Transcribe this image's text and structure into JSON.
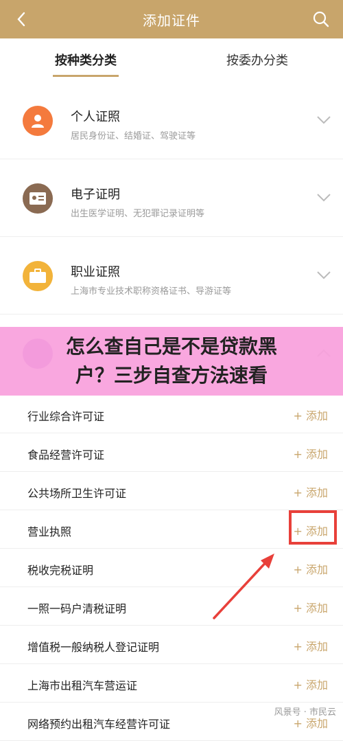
{
  "header": {
    "title": "添加证件",
    "back_icon": "chevron-left-icon",
    "search_icon": "search-icon"
  },
  "tabs": [
    {
      "label": "按种类分类",
      "active": true
    },
    {
      "label": "按委办分类",
      "active": false
    }
  ],
  "categories": [
    {
      "name": "个人证照",
      "desc": "居民身份证、结婚证、驾驶证等",
      "icon": "person-icon",
      "color": "#f47a3d"
    },
    {
      "name": "电子证明",
      "desc": "出生医学证明、无犯罪记录证明等",
      "icon": "id-card-icon",
      "color": "#8a6a52"
    },
    {
      "name": "职业证照",
      "desc": "上海市专业技术职称资格证书、导游证等",
      "icon": "briefcase-icon",
      "color": "#f2b33a"
    }
  ],
  "sub_items": [
    {
      "label": "行业综合许可证",
      "add": "+ 添加"
    },
    {
      "label": "食品经营许可证",
      "add": "+ 添加"
    },
    {
      "label": "公共场所卫生许可证",
      "add": "+ 添加"
    },
    {
      "label": "营业执照",
      "add": "+ 添加"
    },
    {
      "label": "税收完税证明",
      "add": "+ 添加"
    },
    {
      "label": "一照一码户清税证明",
      "add": "+ 添加"
    },
    {
      "label": "增值税一般纳税人登记证明",
      "add": "+ 添加"
    },
    {
      "label": "上海市出租汽车营运证",
      "add": "+ 添加"
    },
    {
      "label": "网络预约出租汽车经营许可证",
      "add": "+ 添加"
    }
  ],
  "banner": {
    "line1": "怎么查自己是不是贷款黑",
    "line2": "户？三步自查方法速看"
  },
  "watermark": "风景号 · 市民云",
  "colors": {
    "accent": "#c8a56b",
    "highlight": "#e8403a"
  }
}
